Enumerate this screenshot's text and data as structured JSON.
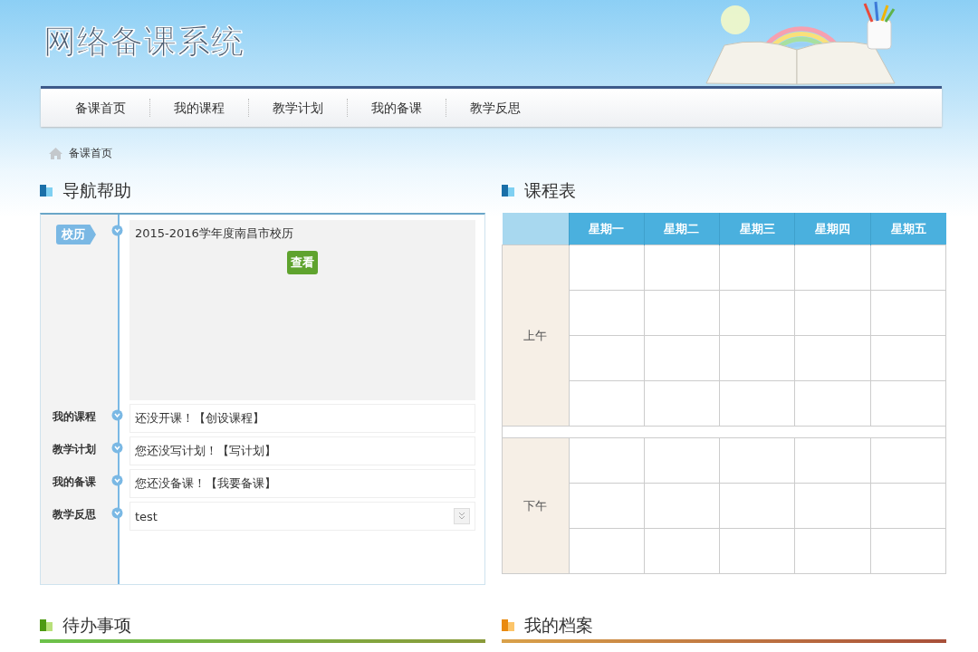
{
  "header": {
    "logo": "网络备课系统"
  },
  "nav": [
    {
      "label": "备课首页"
    },
    {
      "label": "我的课程"
    },
    {
      "label": "教学计划"
    },
    {
      "label": "我的备课"
    },
    {
      "label": "教学反思"
    }
  ],
  "breadcrumb": "备课首页",
  "nav_help": {
    "title": "导航帮助",
    "calendar": {
      "tag": "校历",
      "title": "2015-2016学年度南昌市校历",
      "button": "查看"
    },
    "items": [
      {
        "label": "我的课程",
        "kind": "text",
        "text": "还没开课！【创设课程】"
      },
      {
        "label": "教学计划",
        "kind": "text",
        "text": "您还没写计划！【写计划】"
      },
      {
        "label": "我的备课",
        "kind": "text",
        "text": "您还没备课！【我要备课】"
      },
      {
        "label": "教学反思",
        "kind": "dropdown",
        "value": "test"
      }
    ]
  },
  "schedule": {
    "title": "课程表",
    "columns": [
      "星期一",
      "星期二",
      "星期三",
      "星期四",
      "星期五"
    ],
    "periods": [
      {
        "label": "上午",
        "kind": "morning"
      },
      {
        "label": "下午",
        "kind": "afternoon"
      }
    ]
  },
  "todo": {
    "title": "待办事项"
  },
  "profile": {
    "title": "我的档案"
  }
}
